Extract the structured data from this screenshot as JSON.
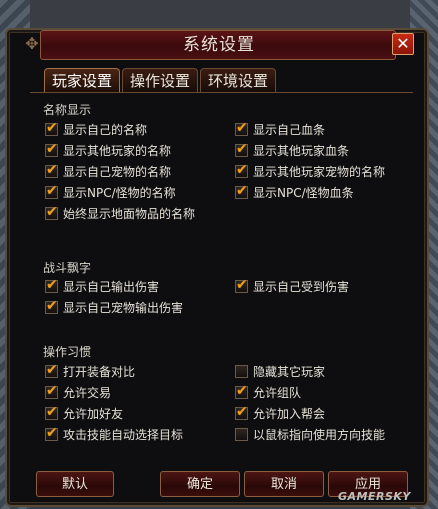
{
  "window": {
    "title": "系统设置",
    "close_label": "✕"
  },
  "tabs": [
    {
      "label": "玩家设置",
      "active": true
    },
    {
      "label": "操作设置",
      "active": false
    },
    {
      "label": "环境设置",
      "active": false
    }
  ],
  "sections": {
    "names": {
      "title": "名称显示",
      "left": [
        {
          "label": "显示自己的名称",
          "checked": true
        },
        {
          "label": "显示其他玩家的名称",
          "checked": true
        },
        {
          "label": "显示自己宠物的名称",
          "checked": true
        },
        {
          "label": "显示NPC/怪物的名称",
          "checked": true
        },
        {
          "label": "始终显示地面物品的名称",
          "checked": true
        }
      ],
      "right": [
        {
          "label": "显示自己血条",
          "checked": true
        },
        {
          "label": "显示其他玩家血条",
          "checked": true
        },
        {
          "label": "显示其他玩家宠物的名称",
          "checked": true
        },
        {
          "label": "显示NPC/怪物血条",
          "checked": true
        }
      ]
    },
    "damage": {
      "title": "战斗飘字",
      "left": [
        {
          "label": "显示自己输出伤害",
          "checked": true
        },
        {
          "label": "显示自己宠物输出伤害",
          "checked": true
        }
      ],
      "right": [
        {
          "label": "显示自己受到伤害",
          "checked": true
        }
      ]
    },
    "habits": {
      "title": "操作习惯",
      "left": [
        {
          "label": "打开装备对比",
          "checked": true
        },
        {
          "label": "允许交易",
          "checked": true
        },
        {
          "label": "允许加好友",
          "checked": true
        },
        {
          "label": "攻击技能自动选择目标",
          "checked": true
        }
      ],
      "right": [
        {
          "label": "隐藏其它玩家",
          "checked": false
        },
        {
          "label": "允许组队",
          "checked": true
        },
        {
          "label": "允许加入帮会",
          "checked": true
        },
        {
          "label": "以鼠标指向使用方向技能",
          "checked": false
        }
      ]
    }
  },
  "buttons": {
    "default": "默认",
    "confirm": "确定",
    "cancel": "取消",
    "apply": "应用"
  },
  "watermark": "GAMERSKY",
  "colors": {
    "accent": "#f0a020",
    "title_bar": "#5c1416"
  }
}
